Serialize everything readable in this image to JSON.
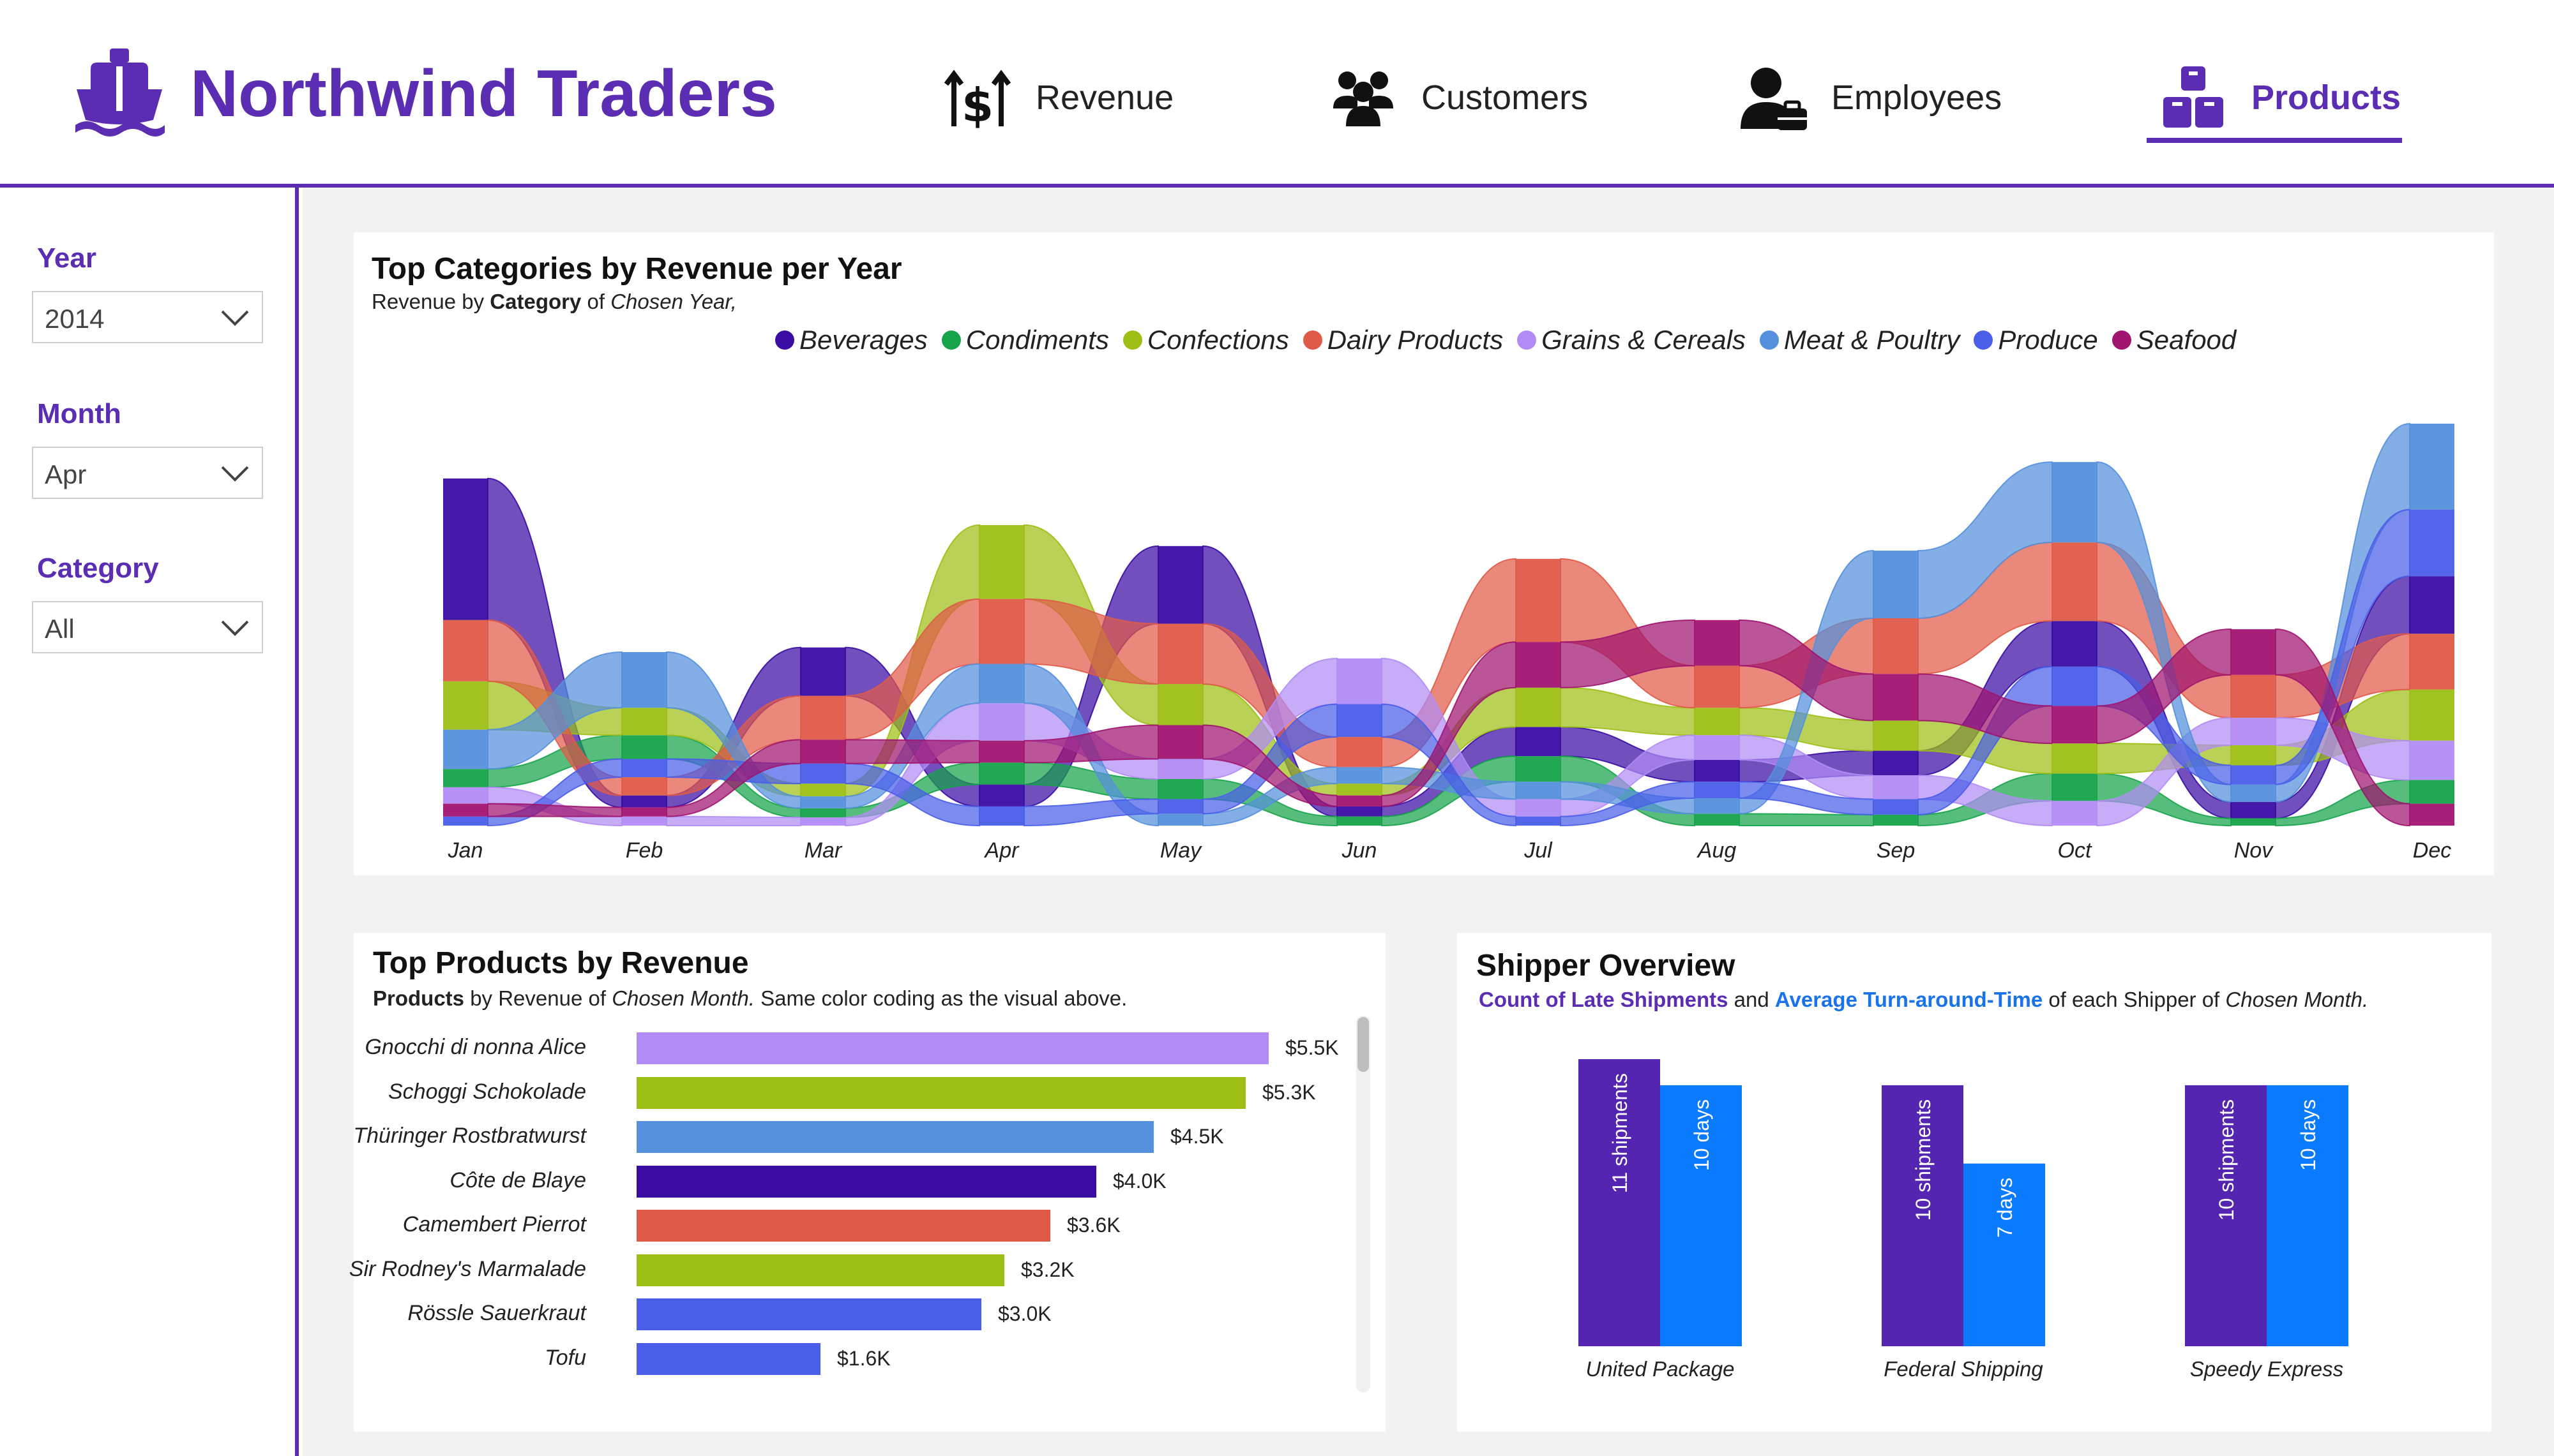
{
  "header": {
    "brand": "Northwind Traders",
    "nav": [
      {
        "label": "Revenue",
        "icon": "revenue-icon"
      },
      {
        "label": "Customers",
        "icon": "customers-icon"
      },
      {
        "label": "Employees",
        "icon": "employees-icon"
      },
      {
        "label": "Products",
        "icon": "products-icon",
        "active": true
      }
    ]
  },
  "sidebar": {
    "year": {
      "title": "Year",
      "value": "2014"
    },
    "month": {
      "title": "Month",
      "value": "Apr"
    },
    "category": {
      "title": "Category",
      "value": "All"
    }
  },
  "colors": {
    "accent": "#5b2db3",
    "Beverages": "#3a0ca3",
    "Condiments": "#16a34a",
    "Confections": "#9dbf15",
    "Dairy Products": "#e05a48",
    "Grains & Cereals": "#b28cf5",
    "Meat & Poultry": "#5590dc",
    "Produce": "#4a5ee8",
    "Seafood": "#a0146f",
    "shipments": "#5325b0",
    "days": "#0a7aff"
  },
  "ribbon": {
    "title": "Top Categories by Revenue per Year",
    "subtitle": {
      "pre": "Revenue by ",
      "bold": "Category",
      "mid": " of ",
      "italic": "Chosen Year,"
    },
    "chart_data": {
      "type": "area",
      "subtype": "ribbon",
      "categories": [
        "Jan",
        "Feb",
        "Mar",
        "Apr",
        "May",
        "Jun",
        "Jul",
        "Aug",
        "Sep",
        "Oct",
        "Nov",
        "Dec"
      ],
      "series": [
        {
          "name": "Beverages",
          "values": [
            15.5,
            1.3,
            5.3,
            2.4,
            8.5,
            1.1,
            3.2,
            2.4,
            2.7,
            5.0,
            1.8,
            6.3
          ]
        },
        {
          "name": "Condiments",
          "values": [
            2.0,
            2.6,
            1.0,
            2.4,
            2.2,
            1.0,
            2.8,
            1.3,
            1.2,
            3.0,
            0.8,
            2.6
          ]
        },
        {
          "name": "Confections",
          "values": [
            5.3,
            3.0,
            1.4,
            8.1,
            4.5,
            1.3,
            4.3,
            3.0,
            3.3,
            3.3,
            2.2,
            5.6
          ]
        },
        {
          "name": "Dairy Products",
          "values": [
            6.7,
            2.0,
            4.8,
            7.1,
            6.6,
            3.3,
            9.1,
            4.6,
            6.1,
            8.6,
            4.7,
            6.1
          ]
        },
        {
          "name": "Grains & Cereals",
          "values": [
            1.8,
            1.0,
            0.9,
            4.1,
            2.2,
            5.0,
            1.9,
            2.7,
            2.6,
            2.7,
            3.0,
            4.3
          ]
        },
        {
          "name": "Meat & Poultry",
          "values": [
            4.3,
            6.1,
            1.3,
            4.3,
            1.3,
            1.8,
            1.9,
            1.7,
            7.4,
            8.8,
            1.9,
            9.4
          ]
        },
        {
          "name": "Produce",
          "values": [
            1.0,
            2.0,
            2.2,
            2.1,
            1.6,
            3.6,
            1.0,
            1.8,
            1.7,
            4.3,
            2.1,
            7.3
          ]
        },
        {
          "name": "Seafood",
          "values": [
            1.4,
            1.0,
            2.6,
            2.4,
            3.7,
            1.2,
            5.0,
            5.0,
            5.1,
            4.1,
            5.0,
            2.4
          ]
        }
      ],
      "grid": false,
      "legend": "top"
    }
  },
  "products": {
    "title": "Top Products by Revenue",
    "subtitle": {
      "bold": "Products",
      "mid": " by Revenue of ",
      "italic": "Chosen Month.",
      "post": " Same color coding as the visual above."
    },
    "chart_data": {
      "type": "bar",
      "orientation": "horizontal",
      "categories": [
        "Gnocchi di nonna Alice",
        "Schoggi Schokolade",
        "Thüringer Rostbratwurst",
        "Côte de Blaye",
        "Camembert Pierrot",
        "Sir Rodney's Marmalade",
        "Rössle Sauerkraut",
        "Tofu"
      ],
      "values": [
        5.5,
        5.3,
        4.5,
        4.0,
        3.6,
        3.2,
        3.0,
        1.6
      ],
      "value_labels": [
        "$5.5K",
        "$5.3K",
        "$4.5K",
        "$4.0K",
        "$3.6K",
        "$3.2K",
        "$3.0K",
        "$1.6K"
      ],
      "category_of_product": [
        "Grains & Cereals",
        "Confections",
        "Meat & Poultry",
        "Beverages",
        "Dairy Products",
        "Confections",
        "Produce",
        "Produce"
      ],
      "unit": "K USD"
    }
  },
  "shipper": {
    "title": "Shipper Overview",
    "subtitle": {
      "late": "Count of Late Shipments",
      "and": " and ",
      "avg": "Average Turn-around-Time",
      "post": " of each Shipper of ",
      "italic": "Chosen Month."
    },
    "chart_data": {
      "type": "bar",
      "categories": [
        "United Package",
        "Federal Shipping",
        "Speedy Express"
      ],
      "series": [
        {
          "name": "Count of Late Shipments",
          "values": [
            11,
            10,
            10
          ],
          "labels": [
            "11 shipments",
            "10 shipments",
            "10 shipments"
          ]
        },
        {
          "name": "Average Turn-around-Time",
          "values": [
            10,
            7,
            10
          ],
          "labels": [
            "10 days",
            "7 days",
            "10 days"
          ]
        }
      ]
    }
  }
}
